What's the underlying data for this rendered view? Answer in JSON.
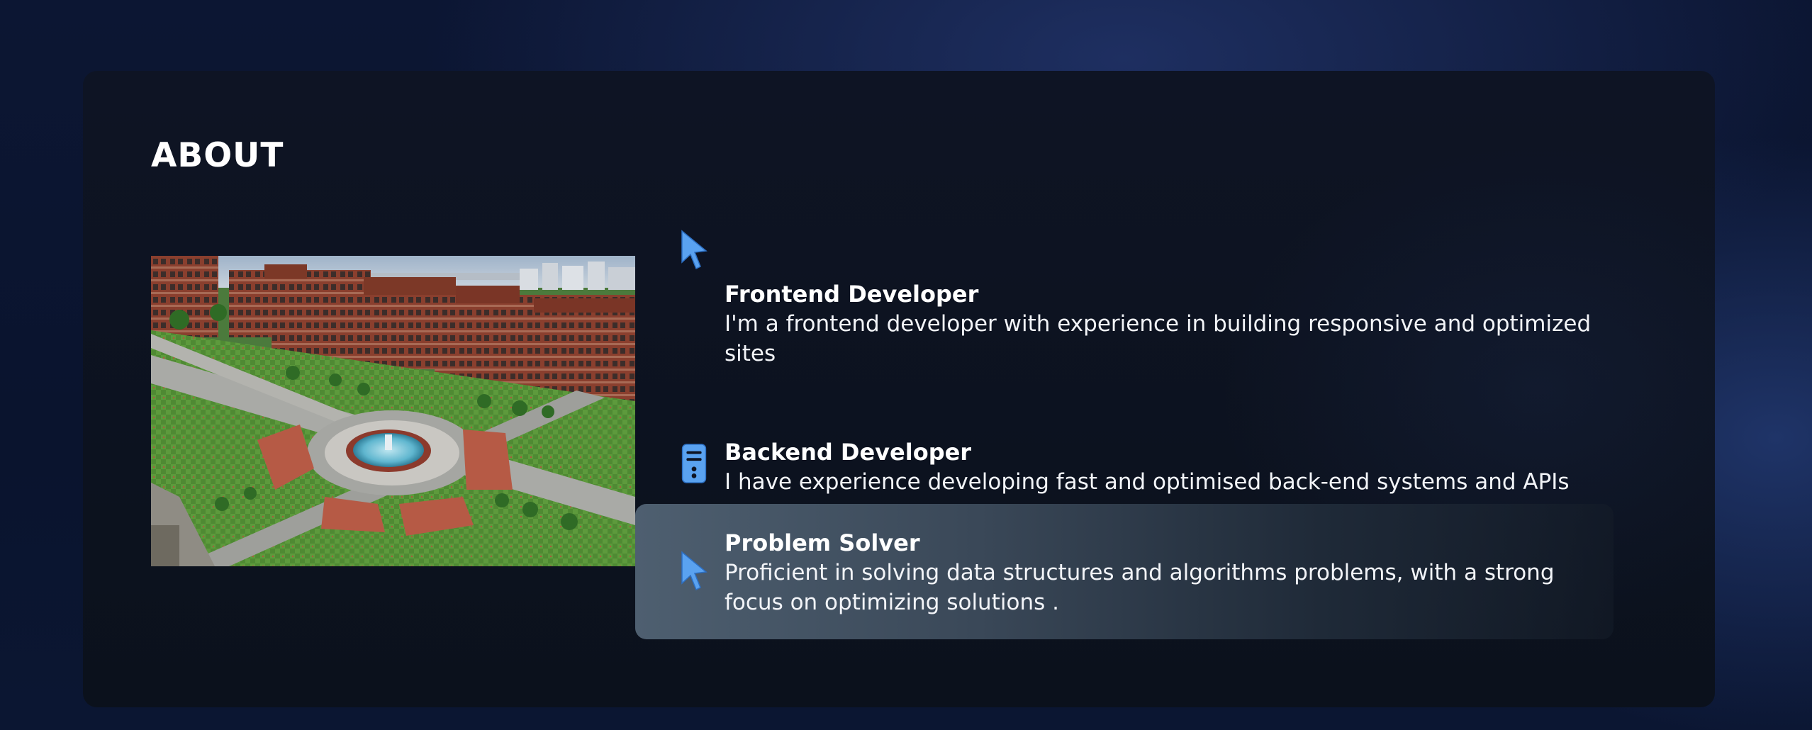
{
  "about": {
    "title": "ABOUT",
    "image_alt": "University campus photo with a circular fountain courtyard and red-brick buildings",
    "items": [
      {
        "icon": "cursor-arrow-icon",
        "heading": "Frontend Developer",
        "description": "I'm a frontend developer with experience in building responsive and optimized sites",
        "highlighted": false
      },
      {
        "icon": "server-icon",
        "heading": "Backend Developer",
        "description": "I have experience developing fast and optimised back-end systems and APIs",
        "highlighted": false
      },
      {
        "icon": "cursor-arrow-icon",
        "heading": "Problem Solver",
        "description": "Proficient in solving data structures and algorithms problems, with a strong focus on optimizing solutions .",
        "highlighted": true
      }
    ]
  },
  "colors": {
    "page_bg": "#0b1632",
    "card_bg": "#0d1320",
    "accent_icon": "#5aa2f0",
    "highlight_bg": "#4e5f70",
    "text": "#ffffff"
  }
}
